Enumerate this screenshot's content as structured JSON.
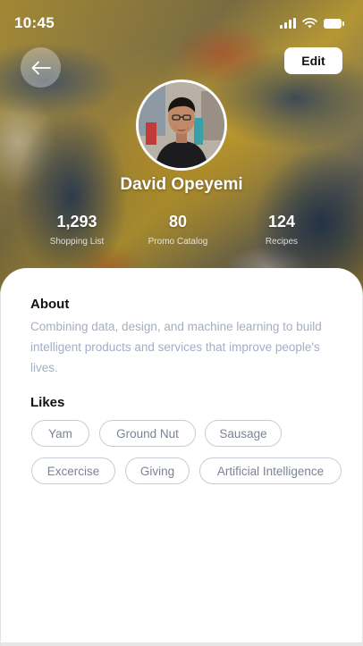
{
  "status_bar": {
    "time": "10:45",
    "icons": [
      "cellular-signal-icon",
      "wifi-icon",
      "battery-icon"
    ]
  },
  "header": {
    "back_icon": "arrow-left-icon",
    "edit_label": "Edit"
  },
  "profile": {
    "name": "David Opeyemi",
    "stats": [
      {
        "value": "1,293",
        "label": "Shopping List"
      },
      {
        "value": "80",
        "label": "Promo Catalog"
      },
      {
        "value": "124",
        "label": "Recipes"
      }
    ]
  },
  "about": {
    "title": "About",
    "text": "Combining data, design, and machine learning to build intelligent products and services that improve people's lives."
  },
  "likes": {
    "title": "Likes",
    "items": [
      "Yam",
      "Ground Nut",
      "Sausage",
      "Excercise",
      "Giving",
      "Artificial Intelligence"
    ]
  },
  "colors": {
    "body_text_muted": "#a3aec4",
    "chip_border": "#c9ccd4",
    "chip_text": "#7a8496",
    "edit_button_bg": "#ffffff"
  }
}
